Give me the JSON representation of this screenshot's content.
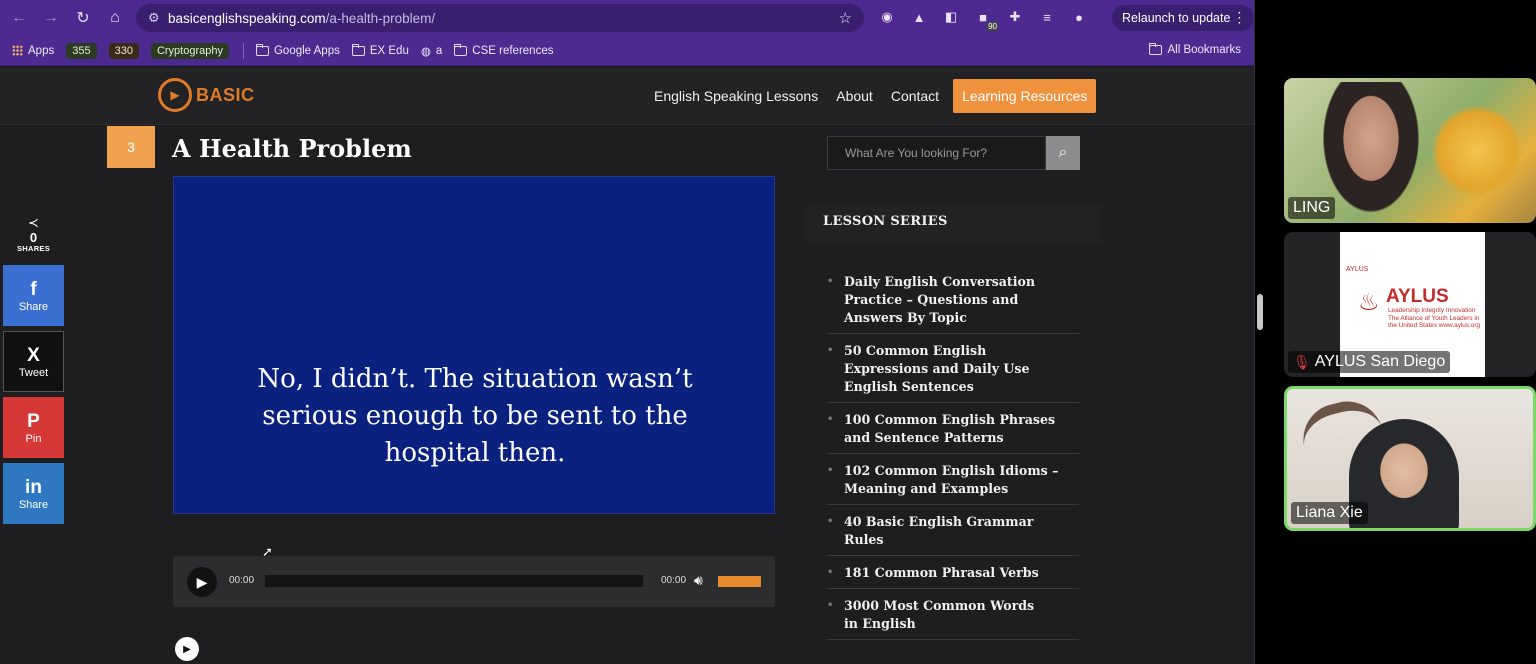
{
  "browser": {
    "url_host": "basicenglishspeaking.com",
    "url_path": "/a-health-problem/",
    "relaunch_label": "Relaunch to update",
    "extension_badge": "90"
  },
  "bookmarks": {
    "items": [
      "Apps",
      "355",
      "330",
      "Cryptography",
      "Google Apps",
      "EX Edu",
      "a",
      "CSE references"
    ],
    "all_bookmarks": "All Bookmarks"
  },
  "site": {
    "logo_text": "BASIC",
    "menu": [
      "English Speaking Lessons",
      "About",
      "Contact"
    ],
    "menu_cta": "Learning Resources"
  },
  "lesson": {
    "number": "3",
    "title": "A Health Problem",
    "caption_lines": [
      "No, I didn’t. The situation wasn’t",
      "serious enough to be sent to the",
      "hospital then."
    ]
  },
  "share": {
    "count": "0",
    "count_label": "SHARES",
    "buttons": [
      {
        "icon": "f",
        "label": "Share"
      },
      {
        "icon": "X",
        "label": "Tweet"
      },
      {
        "icon": "P",
        "label": "Pin"
      },
      {
        "icon": "in",
        "label": "Share"
      }
    ]
  },
  "audio": {
    "current_time": "00:00",
    "duration": "00:00"
  },
  "sidebar": {
    "search_placeholder": "What Are You looking For?",
    "series_heading": "LESSON SERIES",
    "series": [
      "Daily English Conversation Practice – Questions and Answers By Topic",
      "50 Common English Expressions and Daily Use English Sentences",
      "100 Common English Phrases and Sentence Patterns",
      "102 Common English Idioms – Meaning and Examples",
      "40 Basic English Grammar Rules",
      "181 Common Phrasal Verbs",
      "3000 Most Common Words in English"
    ]
  },
  "participants": [
    {
      "name": "LING"
    },
    {
      "name": "AYLUS San Diego",
      "card_brand": "AYLUS",
      "card_top": "AYLUS",
      "card_tagline": "Leadership Integrity Innovation The Alliance of Youth Leaders in the United States www.aylus.org"
    },
    {
      "name": "Liana Xie"
    }
  ]
}
